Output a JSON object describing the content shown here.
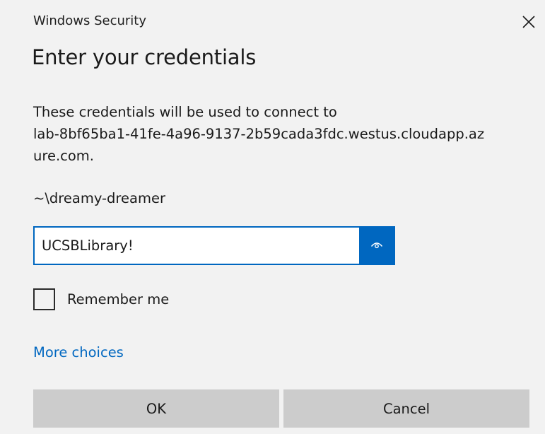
{
  "window": {
    "title": "Windows Security",
    "close_icon": "close-icon"
  },
  "heading": "Enter your credentials",
  "message": {
    "lines": [
      "These credentials will be used to connect to",
      "lab-8bf65ba1-41fe-4a96-9137-2b59cada3fdc.westus.cloudapp.az",
      "ure.com."
    ]
  },
  "username": "~\\dreamy-dreamer",
  "password": {
    "value": "UCSBLibrary!",
    "reveal_icon": "eye-icon"
  },
  "remember": {
    "label": "Remember me",
    "checked": false
  },
  "more_choices": "More choices",
  "buttons": {
    "ok": "OK",
    "cancel": "Cancel"
  },
  "colors": {
    "accent": "#0067c0",
    "background": "#f2f2f2",
    "button": "#cccccc"
  }
}
